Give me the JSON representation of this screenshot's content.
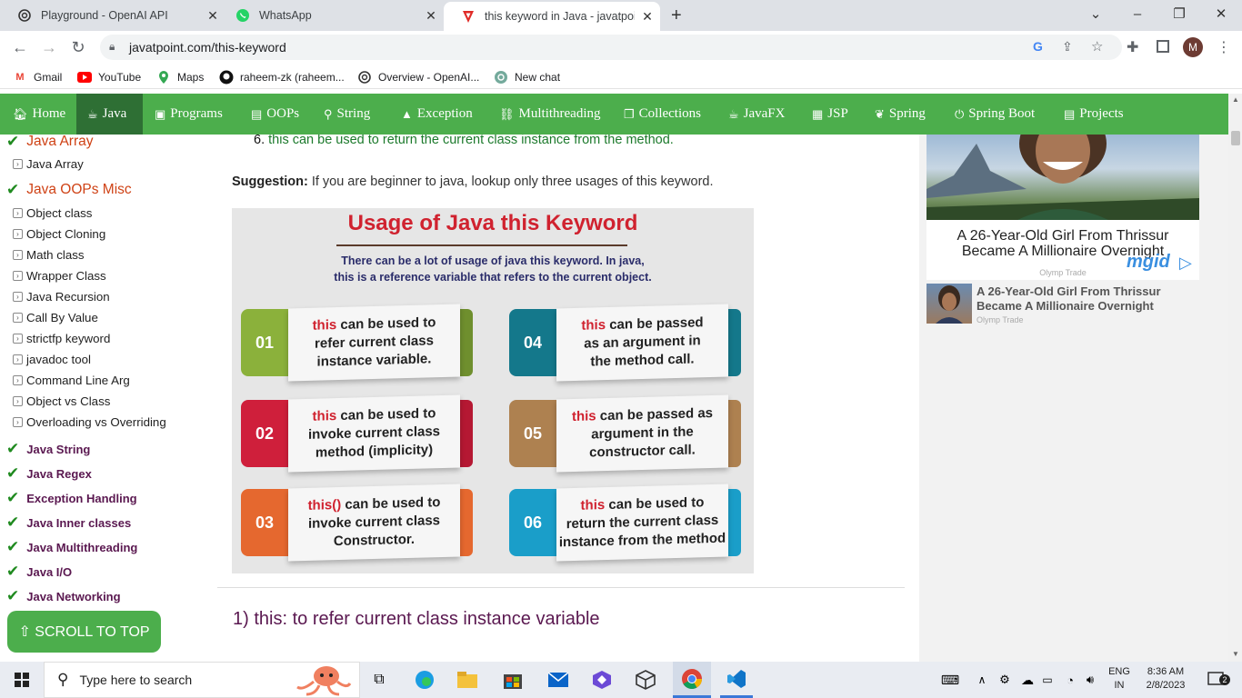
{
  "browser": {
    "tabs": [
      {
        "title": "Playground - OpenAI API",
        "icon": "openai-icon"
      },
      {
        "title": "WhatsApp",
        "icon": "whatsapp-icon"
      },
      {
        "title": "this keyword in Java - javatpoint",
        "icon": "javatpoint-icon"
      }
    ],
    "url": "javatpoint.com/this-keyword",
    "profile_initial": "M",
    "bookmarks": [
      {
        "label": "Gmail",
        "icon": "gmail-icon"
      },
      {
        "label": "YouTube",
        "icon": "youtube-icon"
      },
      {
        "label": "Maps",
        "icon": "maps-icon"
      },
      {
        "label": "raheem-zk (raheem...",
        "icon": "github-icon"
      },
      {
        "label": "Overview - OpenAI...",
        "icon": "openai-icon"
      },
      {
        "label": "New chat",
        "icon": "chatgpt-icon"
      }
    ]
  },
  "nav": {
    "items": [
      "Home",
      "Java",
      "Programs",
      "OOPs",
      "String",
      "Exception",
      "Multithreading",
      "Collections",
      "JavaFX",
      "JSP",
      "Spring",
      "Spring Boot",
      "Projects"
    ],
    "active": "Java"
  },
  "sidebar": {
    "section1": "Java Array",
    "section1_items": [
      "Java Array"
    ],
    "section2": "Java OOPs Misc",
    "section2_items": [
      "Object class",
      "Object Cloning",
      "Math class",
      "Wrapper Class",
      "Java Recursion",
      "Call By Value",
      "strictfp keyword",
      "javadoc tool",
      "Command Line Arg",
      "Object vs Class",
      "Overloading vs Overriding"
    ],
    "topics": [
      "Java String",
      "Java Regex",
      "Exception Handling",
      "Java Inner classes",
      "Java Multithreading",
      "Java I/O",
      "Java Networking"
    ],
    "scroll_to_top": "⇧ SCROLL TO TOP"
  },
  "content": {
    "list_item_number": "6.",
    "list_item_text": "this can be used to return the current class instance from the method.",
    "suggestion_label": "Suggestion:",
    "suggestion_text": "If you are beginner to java, lookup only three usages of this keyword.",
    "infographic": {
      "title": "Usage of Java this Keyword",
      "subtitle_line1": "There can be a lot of usage of java this keyword.  In java,",
      "subtitle_line2": "this is a reference variable that refers to the current object.",
      "cards": [
        {
          "num": "01",
          "kw": "this",
          "l1": " can be used to",
          "l2": "refer current class",
          "l3": "instance variable.",
          "color": "#8bb13b",
          "end": "#6f8f2e"
        },
        {
          "num": "02",
          "kw": "this",
          "l1": " can be used to",
          "l2": "invoke current class",
          "l3": "method (implicity)",
          "color": "#cf1f3b",
          "end": "#b51833"
        },
        {
          "num": "03",
          "kw": "this()",
          "l1": " can be used to",
          "l2": "invoke current class",
          "l3": "Constructor.",
          "color": "#e5682f",
          "end": "#e5682f"
        },
        {
          "num": "04",
          "kw": "this",
          "l1": " can be passed",
          "l2": "as an argument in",
          "l3": "the method call.",
          "color": "#14788b",
          "end": "#14788b"
        },
        {
          "num": "05",
          "kw": "this",
          "l1": " can be passed as",
          "l2": "argument in the",
          "l3": "constructor call.",
          "color": "#ae8150",
          "end": "#ae8150"
        },
        {
          "num": "06",
          "kw": "this",
          "l1": " can be used to",
          "l2": "return the current class",
          "l3": "instance from the method",
          "color": "#1a9ec9",
          "end": "#1a9ec9"
        }
      ]
    },
    "heading": "1) this: to refer current class instance variable"
  },
  "ads": {
    "headline": "A 26-Year-Old Girl From Thrissur Became A Millionaire Overnight",
    "source": "Olymp Trade",
    "brand": "mgid",
    "small_headline": "A 26-Year-Old Girl From Thrissur Became A Millionaire Overnight",
    "small_source": "Olymp Trade"
  },
  "taskbar": {
    "search_placeholder": "Type here to search",
    "lang": "ENG",
    "region": "IN",
    "time": "8:36 AM",
    "date": "2/8/2023",
    "notification_count": "2"
  }
}
